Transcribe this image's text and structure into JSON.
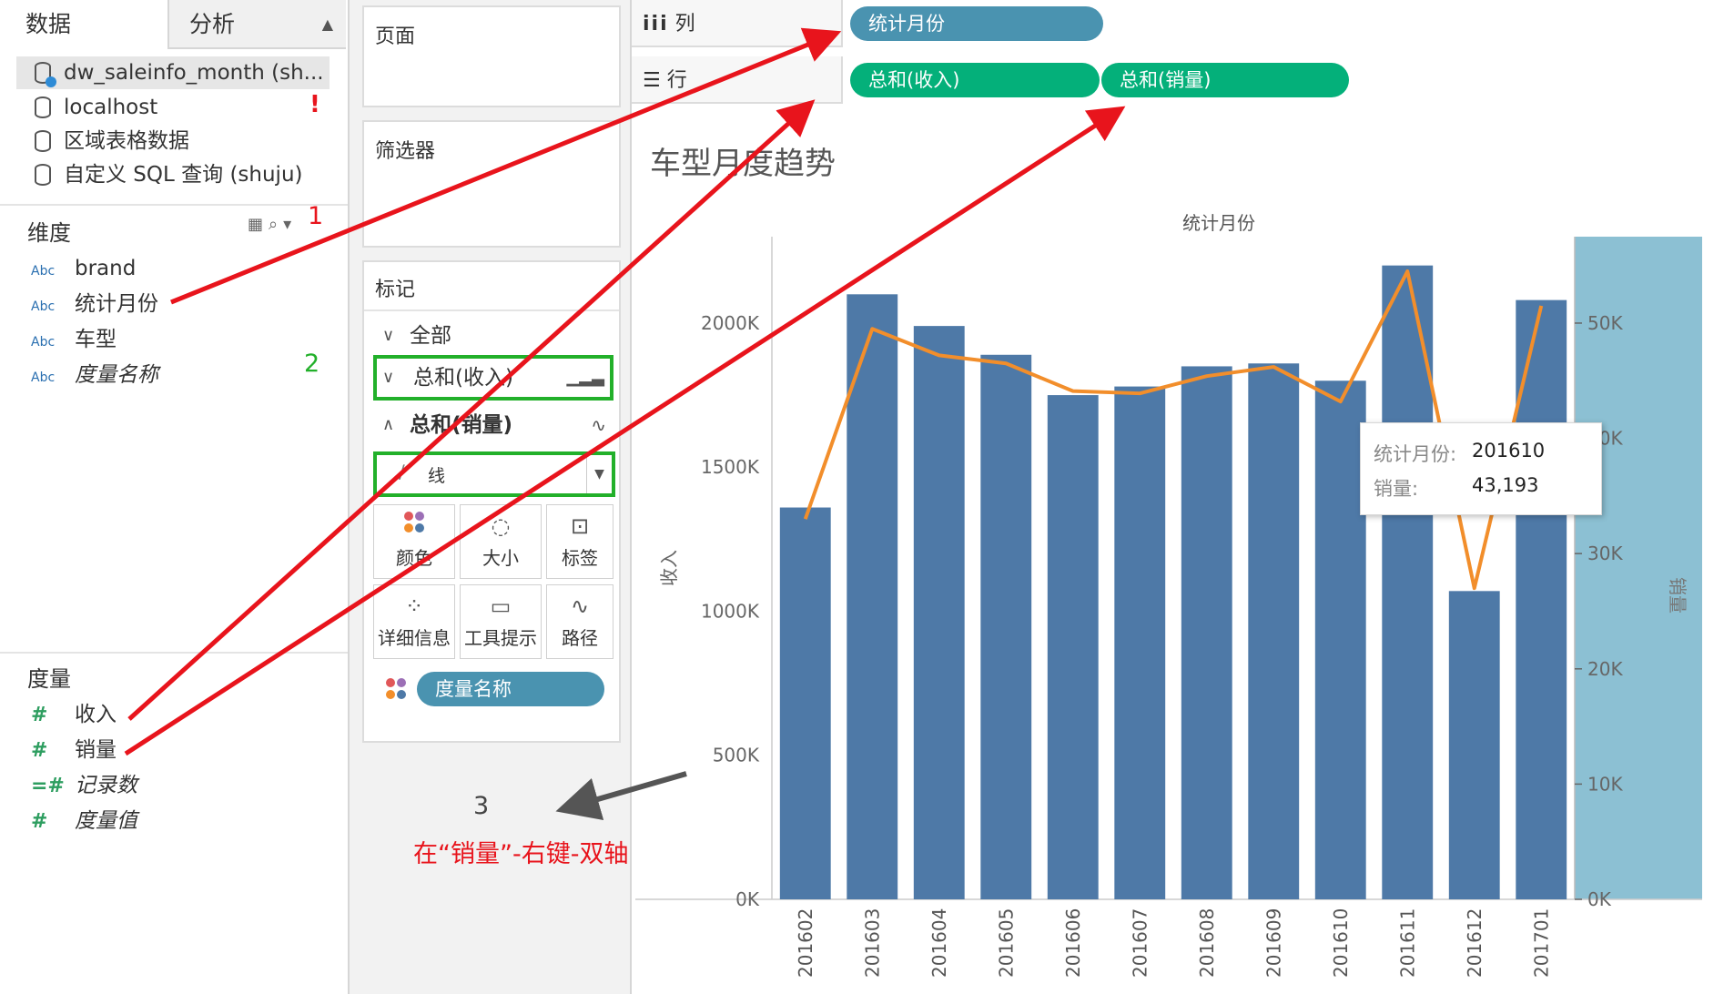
{
  "data_pane": {
    "tabs": [
      "数据",
      "分析"
    ],
    "datasources": [
      {
        "label": "dw_saleinfo_month (sh...",
        "active": true
      },
      {
        "label": "localhost",
        "active": false
      },
      {
        "label": "区域表格数据",
        "active": false
      },
      {
        "label": "自定义 SQL 查询 (shuju)",
        "active": false
      }
    ],
    "warning": "!",
    "dimensions_title": "维度",
    "dimensions": [
      {
        "type": "Abc",
        "label": "brand",
        "italic": false
      },
      {
        "type": "Abc",
        "label": "统计月份",
        "italic": false
      },
      {
        "type": "Abc",
        "label": "车型",
        "italic": false
      },
      {
        "type": "Abc",
        "label": "度量名称",
        "italic": true
      }
    ],
    "measures_title": "度量",
    "measures": [
      {
        "type": "#",
        "label": "收入",
        "italic": false
      },
      {
        "type": "#",
        "label": "销量",
        "italic": false
      },
      {
        "type": "=#",
        "label": "记录数",
        "italic": true
      },
      {
        "type": "#",
        "label": "度量值",
        "italic": true
      }
    ]
  },
  "mid_pane": {
    "pages_title": "页面",
    "filters_title": "筛选器",
    "marks_title": "标记",
    "marks_rows": [
      "全部",
      "总和(收入)",
      "总和(销量)"
    ],
    "mark_type": "线",
    "mark_buttons": [
      {
        "label": "颜色",
        "icon": "color-icon"
      },
      {
        "label": "大小",
        "icon": "size-icon"
      },
      {
        "label": "标签",
        "icon": "label-icon"
      },
      {
        "label": "详细信息",
        "icon": "detail-icon"
      },
      {
        "label": "工具提示",
        "icon": "tooltip-icon"
      },
      {
        "label": "路径",
        "icon": "path-icon"
      }
    ],
    "color_pill": "度量名称"
  },
  "view": {
    "columns_label": "列",
    "rows_label": "行",
    "columns_pill": "统计月份",
    "rows_pills": [
      "总和(收入)",
      "总和(销量)"
    ],
    "tooltip": {
      "k1": "统计月份:",
      "v1": "201610",
      "k2": "销量:",
      "v2": "43,193"
    }
  },
  "annotations": {
    "n1": "1",
    "n2": "2",
    "n3": "3",
    "instruction": "在“销量”-右键-双轴"
  },
  "colors": {
    "bar": "#4e79a7",
    "line": "#f28e2b",
    "highlight": "#8cc0d3",
    "green_pill": "#04b07a",
    "blue_pill": "#4a93b0",
    "arrow": "#e8141c"
  },
  "chart_data": {
    "type": "bar",
    "title": "车型月度趋势",
    "header": "统计月份",
    "ylabel": "收入",
    "y2label": "销量",
    "categories": [
      "201602",
      "201603",
      "201604",
      "201605",
      "201606",
      "201607",
      "201608",
      "201609",
      "201610",
      "201611",
      "201612",
      "201701"
    ],
    "yticks": [
      "0K",
      "500K",
      "1000K",
      "1500K",
      "2000K"
    ],
    "y2ticks": [
      "0K",
      "10K",
      "20K",
      "30K",
      "40K",
      "50K"
    ],
    "ylim": [
      0,
      2300000
    ],
    "y2lim": [
      0,
      57500
    ],
    "highlighted_category": "201701",
    "series": [
      {
        "name": "收入",
        "type": "bar",
        "values": [
          1360000,
          2100000,
          1990000,
          1890000,
          1750000,
          1780000,
          1850000,
          1860000,
          1800000,
          2200000,
          1070000,
          2080000
        ]
      },
      {
        "name": "销量",
        "type": "line",
        "values": [
          33000,
          49500,
          47200,
          46500,
          44100,
          43900,
          45400,
          46200,
          43193,
          54500,
          27000,
          51500
        ]
      }
    ]
  }
}
